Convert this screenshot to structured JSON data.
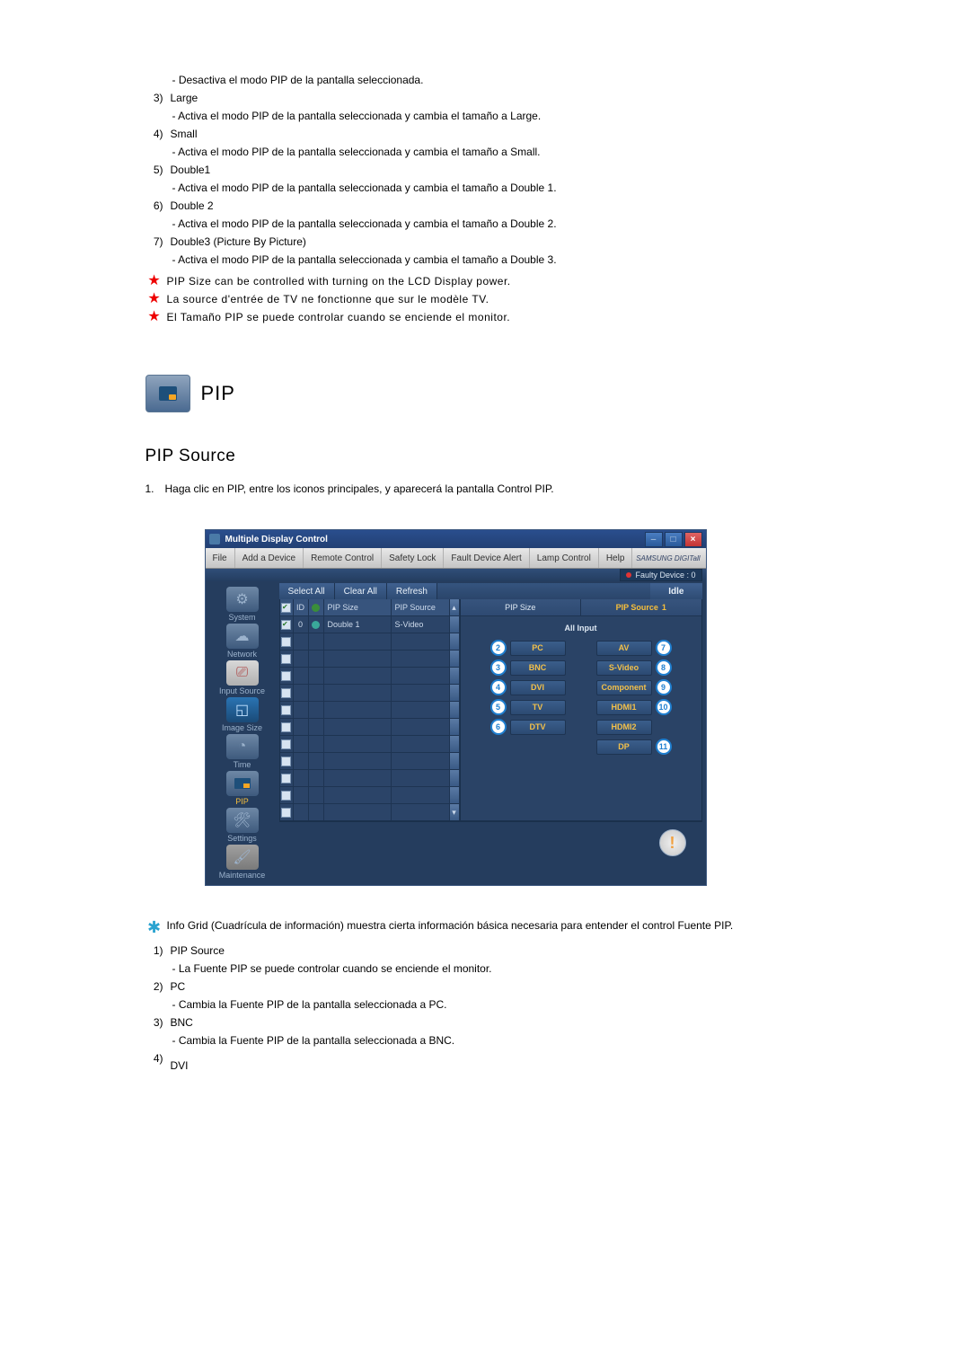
{
  "top": {
    "desc0": "- Desactiva el modo PIP de la pantalla seleccionada.",
    "items": [
      {
        "n": "3)",
        "l": "Large",
        "d": "- Activa el modo PIP de la pantalla seleccionada y cambia el tamaño a Large."
      },
      {
        "n": "4)",
        "l": "Small",
        "d": "- Activa el modo PIP de la pantalla seleccionada y cambia el tamaño a Small."
      },
      {
        "n": "5)",
        "l": "Double1",
        "d": "- Activa el modo PIP de la pantalla seleccionada y cambia el tamaño a Double 1."
      },
      {
        "n": "6)",
        "l": "Double 2",
        "d": "- Activa el modo PIP de la pantalla seleccionada y cambia el tamaño a Double 2."
      },
      {
        "n": "7)",
        "l": "Double3 (Picture By Picture)",
        "d": "- Activa el modo PIP de la pantalla seleccionada y cambia el tamaño a Double 3."
      }
    ],
    "notes": [
      "PIP Size can be controlled with turning on the LCD Display power.",
      "La source d'entrée de TV ne fonctionne que sur le modèle TV.",
      "El Tamaño PIP se puede controlar cuando se enciende el monitor."
    ]
  },
  "section": {
    "heading": "PIP",
    "sub": "PIP Source",
    "intro_n": "1.",
    "intro": "Haga clic en PIP, entre los iconos principales, y aparecerá la pantalla Control PIP."
  },
  "app": {
    "title": "Multiple Display Control",
    "menu": [
      "File",
      "Add a Device",
      "Remote Control",
      "Safety Lock",
      "Fault Device Alert",
      "Lamp Control",
      "Help"
    ],
    "brand": "SAMSUNG DIGITall",
    "fault": "Faulty Device : 0",
    "toolbar": {
      "select": "Select All",
      "clear": "Clear All",
      "refresh": "Refresh",
      "idle": "Idle"
    },
    "sidebar": [
      {
        "t": "System"
      },
      {
        "t": "Network"
      },
      {
        "t": "Input Source"
      },
      {
        "t": "Image Size"
      },
      {
        "t": "Time"
      },
      {
        "t": "PIP"
      },
      {
        "t": "Settings"
      },
      {
        "t": "Maintenance"
      }
    ],
    "grid": {
      "h": {
        "chk": "",
        "id": "ID",
        "st": "",
        "pz": "PIP Size",
        "ps": "PIP Source"
      },
      "r": {
        "id": "0",
        "pz": "Double 1",
        "ps": "S-Video"
      }
    },
    "info": {
      "left_hdr": "PIP Size",
      "right_hdr": "PIP Source",
      "all": "All Input",
      "left_btns": [
        "PC",
        "BNC",
        "DVI",
        "TV",
        "DTV"
      ],
      "left_nums": [
        "2",
        "3",
        "4",
        "5",
        "6"
      ],
      "right_btns": [
        "AV",
        "S-Video",
        "Component",
        "HDMI1",
        "HDMI2",
        "DP"
      ],
      "right_nums": [
        "7",
        "8",
        "9",
        "10",
        "",
        "11"
      ],
      "badge1": "1"
    }
  },
  "bottom": {
    "star": "Info Grid (Cuadrícula de información) muestra cierta información básica necesaria para entender el control Fuente PIP.",
    "items": [
      {
        "n": "1)",
        "l": "PIP Source",
        "d": "- La Fuente PIP se puede controlar cuando se enciende el monitor."
      },
      {
        "n": "2)",
        "l": "PC",
        "d": "- Cambia la Fuente PIP de la pantalla seleccionada a PC."
      },
      {
        "n": "3)",
        "l": "BNC",
        "d": "- Cambia la Fuente PIP de la pantalla seleccionada a BNC."
      },
      {
        "n": "4)",
        "l": "DVI",
        "d": ""
      }
    ]
  }
}
